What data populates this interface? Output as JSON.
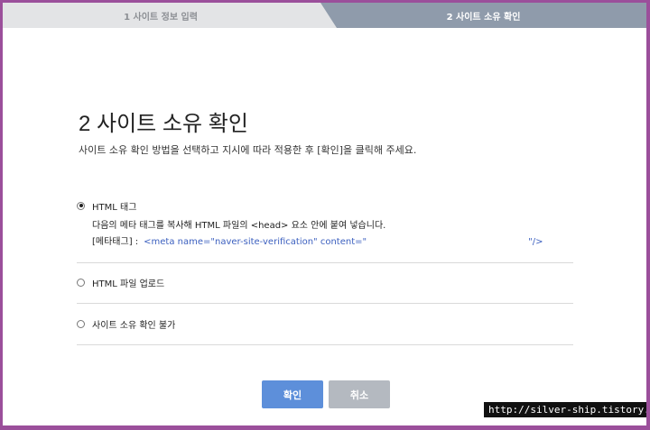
{
  "steps": {
    "step1": "1 사이트 정보 입력",
    "step2": "2 사이트 소유 확인"
  },
  "page": {
    "title": "2 사이트 소유 확인",
    "description": "사이트 소유 확인 방법을 선택하고 지시에 따라 적용한 후 [확인]을 클릭해 주세요."
  },
  "options": [
    {
      "label": "HTML 태그",
      "selected": true,
      "detail": "다음의 메타 태그를 복사해 HTML 파일의 <head> 요소 안에 붙여 넣습니다.",
      "meta_label": "[메타태그] :",
      "meta_code": "<meta name=\"naver-site-verification\" content=\"",
      "meta_code_end": "\"/>"
    },
    {
      "label": "HTML 파일 업로드",
      "selected": false
    },
    {
      "label": "사이트 소유 확인 불가",
      "selected": false
    }
  ],
  "buttons": {
    "confirm": "확인",
    "cancel": "취소"
  },
  "watermark": "http://silver-ship.tistory.com",
  "colors": {
    "frame": "#9b4f9b",
    "active_step": "#8f9bab",
    "confirm_button": "#5d8fda",
    "cancel_button": "#b4b9c0",
    "code_text": "#3b5fbf"
  }
}
